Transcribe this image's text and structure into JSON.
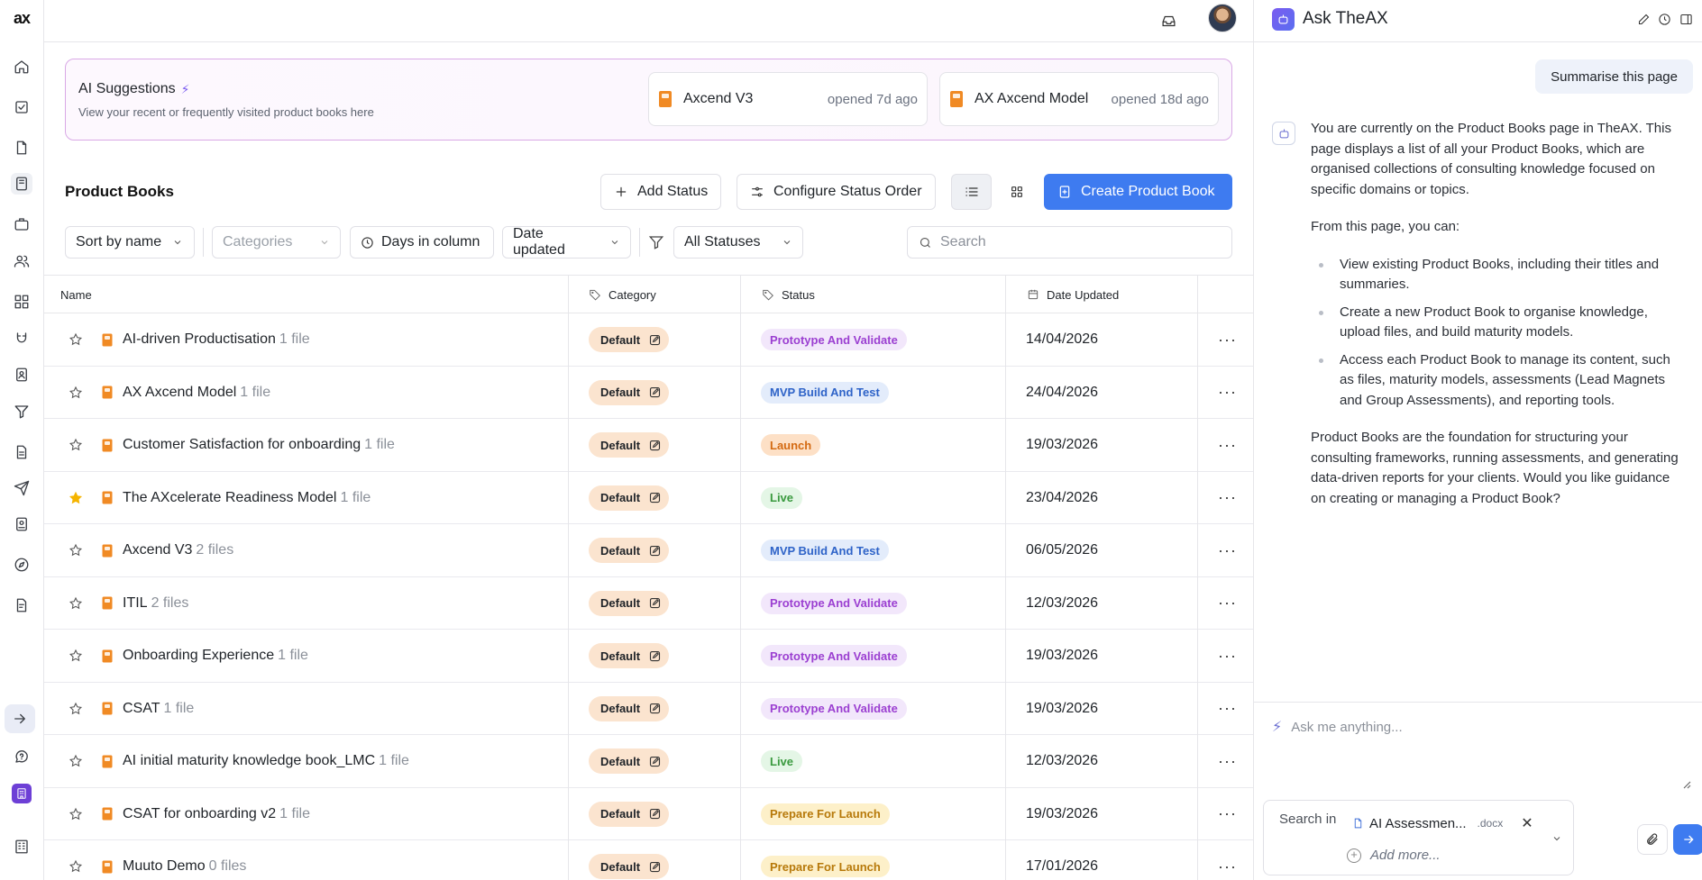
{
  "app": {
    "logo": "ax"
  },
  "ai_suggestions": {
    "title": "AI Suggestions",
    "subtitle": "View your recent or frequently visited product books here",
    "cards": [
      {
        "name": "Axcend V3",
        "opened": "opened 7d ago"
      },
      {
        "name": "AX Axcend Model",
        "opened": "opened 18d ago"
      }
    ]
  },
  "toolbar": {
    "page_title": "Product Books",
    "add_status": "Add Status",
    "configure_status_order": "Configure Status Order",
    "create_product_book": "Create Product Book"
  },
  "filters": {
    "sort": "Sort by name",
    "categories_placeholder": "Categories",
    "days_in_column": "Days in column",
    "date_updated": "Date updated",
    "statuses": "All Statuses",
    "search_placeholder": "Search"
  },
  "table": {
    "headers": {
      "name": "Name",
      "category": "Category",
      "status": "Status",
      "date_updated": "Date Updated"
    },
    "rows": [
      {
        "name": "AI-driven Productisation",
        "files": "1 file",
        "starred": false,
        "category": "Default",
        "status": "Prototype And Validate",
        "status_kind": "proto",
        "date": "14/04/2026"
      },
      {
        "name": "AX Axcend Model",
        "files": "1 file",
        "starred": false,
        "category": "Default",
        "status": "MVP Build And Test",
        "status_kind": "mvp",
        "date": "24/04/2026"
      },
      {
        "name": "Customer Satisfaction for onboarding",
        "files": "1 file",
        "starred": false,
        "category": "Default",
        "status": "Launch",
        "status_kind": "launch",
        "date": "19/03/2026"
      },
      {
        "name": "The AXcelerate Readiness Model ",
        "files": "1 file",
        "starred": true,
        "category": "Default",
        "status": "Live",
        "status_kind": "live",
        "date": "23/04/2026"
      },
      {
        "name": "Axcend V3",
        "files": "2 files",
        "starred": false,
        "category": "Default",
        "status": "MVP Build And Test",
        "status_kind": "mvp",
        "date": "06/05/2026"
      },
      {
        "name": "ITIL",
        "files": "2 files",
        "starred": false,
        "category": "Default",
        "status": "Prototype And Validate",
        "status_kind": "proto",
        "date": "12/03/2026"
      },
      {
        "name": "Onboarding Experience",
        "files": "1 file",
        "starred": false,
        "category": "Default",
        "status": "Prototype And Validate",
        "status_kind": "proto",
        "date": "19/03/2026"
      },
      {
        "name": "CSAT",
        "files": "1 file",
        "starred": false,
        "category": "Default",
        "status": "Prototype And Validate",
        "status_kind": "proto",
        "date": "19/03/2026"
      },
      {
        "name": "AI initial maturity knowledge book_LMC",
        "files": "1 file",
        "starred": false,
        "category": "Default",
        "status": "Live",
        "status_kind": "live",
        "date": "12/03/2026"
      },
      {
        "name": "CSAT for onboarding v2",
        "files": "1 file",
        "starred": false,
        "category": "Default",
        "status": "Prepare For Launch",
        "status_kind": "prep",
        "date": "19/03/2026"
      },
      {
        "name": "Muuto Demo",
        "files": "0 files",
        "starred": false,
        "category": "Default",
        "status": "Prepare For Launch",
        "status_kind": "prep",
        "date": "17/01/2026"
      }
    ]
  },
  "chat": {
    "title": "Ask TheAX",
    "user_message": "Summarise this page",
    "ai_intro": "You are currently on the Product Books page in TheAX. This page displays a list of all your Product Books, which are organised collections of consulting knowledge focused on specific domains or topics.",
    "ai_lead": "From this page, you can:",
    "ai_bullets": [
      "View existing Product Books, including their titles and summaries.",
      "Create a new Product Book to organise knowledge, upload files, and build maturity models.",
      "Access each Product Book to manage its content, such as files, maturity models, assessments (Lead Magnets and Group Assessments), and reporting tools."
    ],
    "ai_outro": "Product Books are the foundation for structuring your consulting frameworks, running assessments, and generating data-driven reports for your clients. Would you like guidance on creating or managing a Product Book?",
    "input_placeholder": "Ask me anything...",
    "search_in_label": "Search in",
    "context_file": "AI Assessmen...",
    "context_ext": ".docx",
    "add_more": "Add more..."
  },
  "colors": {
    "primary": "#3e7bf0",
    "brand_accent": "#f08a24",
    "suggest_border": "#d9a9e6",
    "category_bg": "#fbe4cf"
  }
}
